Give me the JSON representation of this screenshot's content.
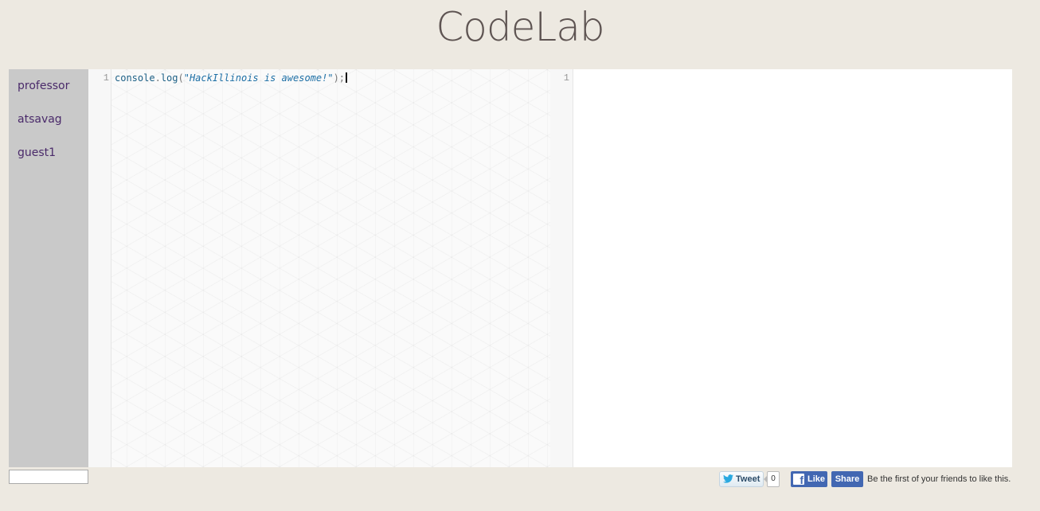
{
  "app": {
    "title": "CodeLab"
  },
  "sidebar": {
    "users": [
      {
        "name": "professor"
      },
      {
        "name": "atsavag"
      },
      {
        "name": "guest1"
      }
    ]
  },
  "editor": {
    "line_number": "1",
    "code": {
      "ident1": "console",
      "dot": ".",
      "ident2": "log",
      "open": "(",
      "string": "\"HackIllinois is awesome!\"",
      "close": ");"
    }
  },
  "output": {
    "line_number": "1"
  },
  "footer": {
    "name_input_value": "",
    "tweet_label": "Tweet",
    "tweet_count": "0",
    "like_label": "Like",
    "share_label": "Share",
    "like_text": "Be the first of your friends to like this."
  },
  "colors": {
    "background": "#ede9e1",
    "sidebar": "#c9c9c9",
    "user_link": "#4a2a6a",
    "facebook": "#4267b2"
  },
  "icons": {
    "tweet": "twitter-bird-icon",
    "like": "facebook-f-icon"
  }
}
